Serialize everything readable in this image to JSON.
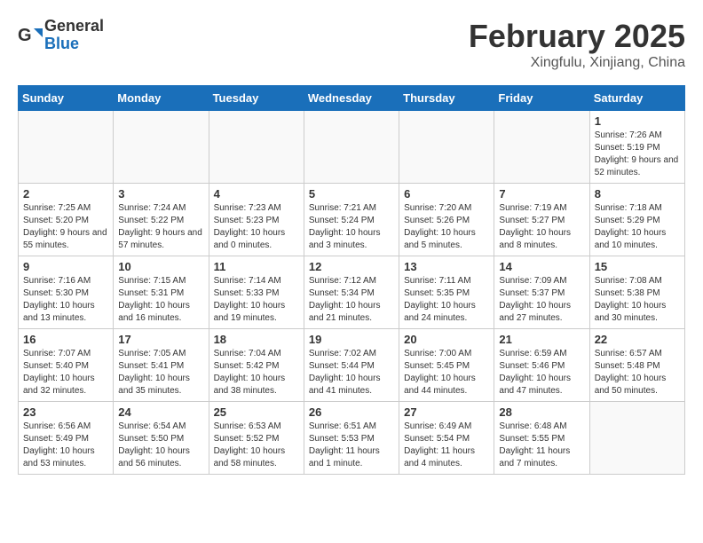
{
  "header": {
    "logo_line1": "General",
    "logo_line2": "Blue",
    "main_title": "February 2025",
    "subtitle": "Xingfulu, Xinjiang, China"
  },
  "days_of_week": [
    "Sunday",
    "Monday",
    "Tuesday",
    "Wednesday",
    "Thursday",
    "Friday",
    "Saturday"
  ],
  "weeks": [
    [
      {
        "day": "",
        "info": ""
      },
      {
        "day": "",
        "info": ""
      },
      {
        "day": "",
        "info": ""
      },
      {
        "day": "",
        "info": ""
      },
      {
        "day": "",
        "info": ""
      },
      {
        "day": "",
        "info": ""
      },
      {
        "day": "1",
        "info": "Sunrise: 7:26 AM\nSunset: 5:19 PM\nDaylight: 9 hours and 52 minutes."
      }
    ],
    [
      {
        "day": "2",
        "info": "Sunrise: 7:25 AM\nSunset: 5:20 PM\nDaylight: 9 hours and 55 minutes."
      },
      {
        "day": "3",
        "info": "Sunrise: 7:24 AM\nSunset: 5:22 PM\nDaylight: 9 hours and 57 minutes."
      },
      {
        "day": "4",
        "info": "Sunrise: 7:23 AM\nSunset: 5:23 PM\nDaylight: 10 hours and 0 minutes."
      },
      {
        "day": "5",
        "info": "Sunrise: 7:21 AM\nSunset: 5:24 PM\nDaylight: 10 hours and 3 minutes."
      },
      {
        "day": "6",
        "info": "Sunrise: 7:20 AM\nSunset: 5:26 PM\nDaylight: 10 hours and 5 minutes."
      },
      {
        "day": "7",
        "info": "Sunrise: 7:19 AM\nSunset: 5:27 PM\nDaylight: 10 hours and 8 minutes."
      },
      {
        "day": "8",
        "info": "Sunrise: 7:18 AM\nSunset: 5:29 PM\nDaylight: 10 hours and 10 minutes."
      }
    ],
    [
      {
        "day": "9",
        "info": "Sunrise: 7:16 AM\nSunset: 5:30 PM\nDaylight: 10 hours and 13 minutes."
      },
      {
        "day": "10",
        "info": "Sunrise: 7:15 AM\nSunset: 5:31 PM\nDaylight: 10 hours and 16 minutes."
      },
      {
        "day": "11",
        "info": "Sunrise: 7:14 AM\nSunset: 5:33 PM\nDaylight: 10 hours and 19 minutes."
      },
      {
        "day": "12",
        "info": "Sunrise: 7:12 AM\nSunset: 5:34 PM\nDaylight: 10 hours and 21 minutes."
      },
      {
        "day": "13",
        "info": "Sunrise: 7:11 AM\nSunset: 5:35 PM\nDaylight: 10 hours and 24 minutes."
      },
      {
        "day": "14",
        "info": "Sunrise: 7:09 AM\nSunset: 5:37 PM\nDaylight: 10 hours and 27 minutes."
      },
      {
        "day": "15",
        "info": "Sunrise: 7:08 AM\nSunset: 5:38 PM\nDaylight: 10 hours and 30 minutes."
      }
    ],
    [
      {
        "day": "16",
        "info": "Sunrise: 7:07 AM\nSunset: 5:40 PM\nDaylight: 10 hours and 32 minutes."
      },
      {
        "day": "17",
        "info": "Sunrise: 7:05 AM\nSunset: 5:41 PM\nDaylight: 10 hours and 35 minutes."
      },
      {
        "day": "18",
        "info": "Sunrise: 7:04 AM\nSunset: 5:42 PM\nDaylight: 10 hours and 38 minutes."
      },
      {
        "day": "19",
        "info": "Sunrise: 7:02 AM\nSunset: 5:44 PM\nDaylight: 10 hours and 41 minutes."
      },
      {
        "day": "20",
        "info": "Sunrise: 7:00 AM\nSunset: 5:45 PM\nDaylight: 10 hours and 44 minutes."
      },
      {
        "day": "21",
        "info": "Sunrise: 6:59 AM\nSunset: 5:46 PM\nDaylight: 10 hours and 47 minutes."
      },
      {
        "day": "22",
        "info": "Sunrise: 6:57 AM\nSunset: 5:48 PM\nDaylight: 10 hours and 50 minutes."
      }
    ],
    [
      {
        "day": "23",
        "info": "Sunrise: 6:56 AM\nSunset: 5:49 PM\nDaylight: 10 hours and 53 minutes."
      },
      {
        "day": "24",
        "info": "Sunrise: 6:54 AM\nSunset: 5:50 PM\nDaylight: 10 hours and 56 minutes."
      },
      {
        "day": "25",
        "info": "Sunrise: 6:53 AM\nSunset: 5:52 PM\nDaylight: 10 hours and 58 minutes."
      },
      {
        "day": "26",
        "info": "Sunrise: 6:51 AM\nSunset: 5:53 PM\nDaylight: 11 hours and 1 minute."
      },
      {
        "day": "27",
        "info": "Sunrise: 6:49 AM\nSunset: 5:54 PM\nDaylight: 11 hours and 4 minutes."
      },
      {
        "day": "28",
        "info": "Sunrise: 6:48 AM\nSunset: 5:55 PM\nDaylight: 11 hours and 7 minutes."
      },
      {
        "day": "",
        "info": ""
      }
    ]
  ]
}
